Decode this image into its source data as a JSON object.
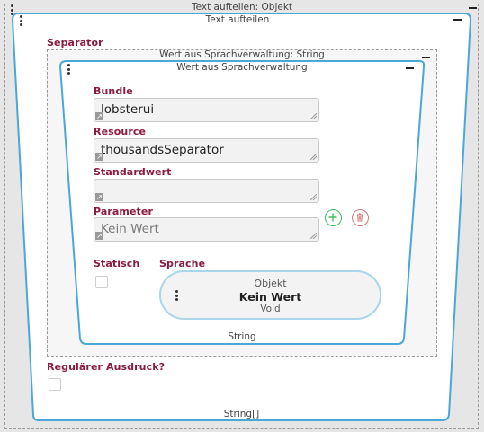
{
  "outer": {
    "title": "Text aufteilen: Objekt"
  },
  "text_split": {
    "title": "Text aufteilen",
    "footer": "String[]"
  },
  "separator": {
    "label": "Separator"
  },
  "lang_value_outer": {
    "title": "Wert aus Sprachverwaltung: String"
  },
  "lang_value": {
    "title": "Wert aus Sprachverwaltung",
    "footer": "String",
    "fields": {
      "bundle": {
        "label": "Bundle",
        "value": "lobsterui"
      },
      "resource": {
        "label": "Resource",
        "value": "thousandsSeparator"
      },
      "default": {
        "label": "Standardwert",
        "value": ""
      },
      "parameter": {
        "label": "Parameter",
        "placeholder": "Kein Wert"
      }
    },
    "static": {
      "label": "Statisch"
    },
    "language": {
      "label": "Sprache",
      "pill": {
        "type": "Objekt",
        "value": "Kein Wert",
        "subtype": "Void"
      }
    }
  },
  "regex": {
    "label": "Regulärer Ausdruck?"
  },
  "colors": {
    "accent": "#4aa8d8",
    "label": "#8b1a3d",
    "add": "#3cbf5a",
    "delete": "#d77a7a"
  },
  "icons": {
    "add": "plus-circle-icon",
    "delete": "trash-icon",
    "drag": "drag-handle-icon",
    "collapse": "minus-icon",
    "field": "expand-arrow-icon"
  }
}
